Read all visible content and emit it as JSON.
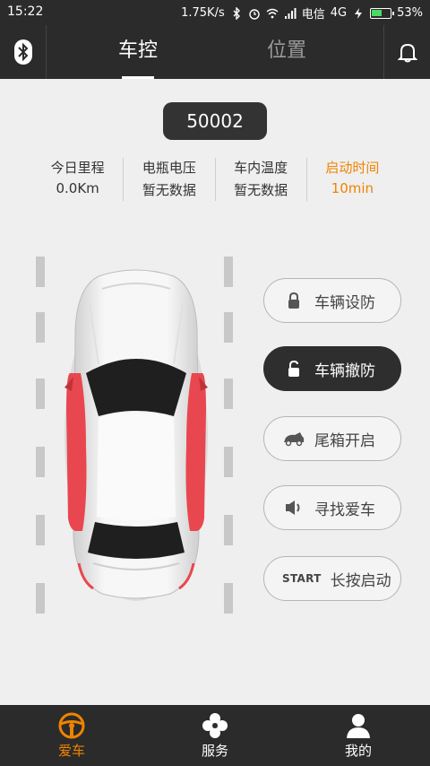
{
  "status_bar": {
    "time": "15:22",
    "speed": "1.75K/s",
    "carrier": "电信",
    "network": "4G",
    "battery": "53%"
  },
  "top_bar": {
    "tabs": [
      {
        "label": "车控",
        "active": true
      },
      {
        "label": "位置",
        "active": false
      }
    ]
  },
  "vehicle": {
    "plate": "50002"
  },
  "stats": [
    {
      "label": "今日里程",
      "value": "0.0Km"
    },
    {
      "label": "电瓶电压",
      "value": "暂无数据"
    },
    {
      "label": "车内温度",
      "value": "暂无数据"
    },
    {
      "label": "启动时间",
      "value": "10min"
    }
  ],
  "controls": {
    "arm": "车辆设防",
    "disarm": "车辆撤防",
    "trunk": "尾箱开启",
    "find": "寻找爱车",
    "start_tag": "START",
    "start": "长按启动"
  },
  "bottom_nav": [
    {
      "label": "爱车",
      "active": true
    },
    {
      "label": "服务",
      "active": false
    },
    {
      "label": "我的",
      "active": false
    }
  ],
  "colors": {
    "accent": "#f08300",
    "dark": "#2b2b2b",
    "door_highlight": "#e8474f"
  }
}
